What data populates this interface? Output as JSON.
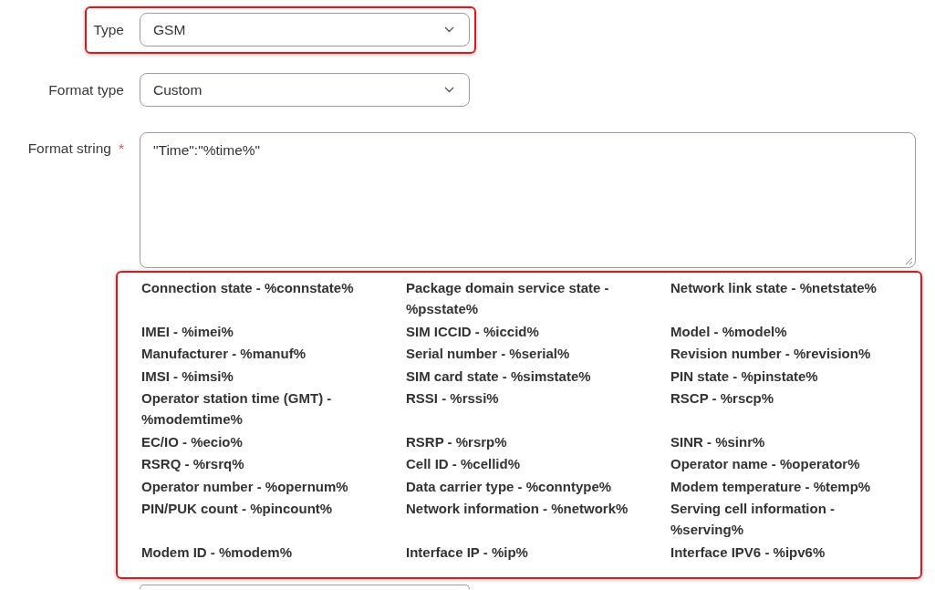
{
  "fields": [
    {
      "kind": "select",
      "label": "Type",
      "value": "GSM",
      "highlighted": true
    },
    {
      "kind": "select",
      "label": "Format type",
      "value": "Custom"
    },
    {
      "kind": "textarea",
      "label": "Format string",
      "required_mark": "*",
      "value": "\"Time\":\"%time%\""
    }
  ],
  "variables": {
    "highlighted": true,
    "items": [
      "Connection state - %connstate%",
      "Package domain service state - %psstate%",
      "Network link state - %netstate%",
      "IMEI - %imei%",
      "SIM ICCID - %iccid%",
      "Model - %model%",
      "Manufacturer - %manuf%",
      "Serial number - %serial%",
      "Revision number - %revision%",
      "IMSI - %imsi%",
      "SIM card state - %simstate%",
      "PIN state - %pinstate%",
      "Operator station time (GMT) - %modemtime%",
      "RSSI - %rssi%",
      "RSCP - %rscp%",
      "EC/IO - %ecio%",
      "RSRP - %rsrp%",
      "SINR - %sinr%",
      "RSRQ - %rsrq%",
      "Cell ID - %cellid%",
      "Operator name - %operator%",
      "Operator number - %opernum%",
      "Data carrier type - %conntype%",
      "Modem temperature - %temp%",
      "PIN/PUK count - %pincount%",
      "Network information - %network%",
      "Serving cell information - %serving%",
      "Modem ID - %modem%",
      "Interface IP - %ip%",
      "Interface IPV6 - %ipv6%"
    ]
  }
}
